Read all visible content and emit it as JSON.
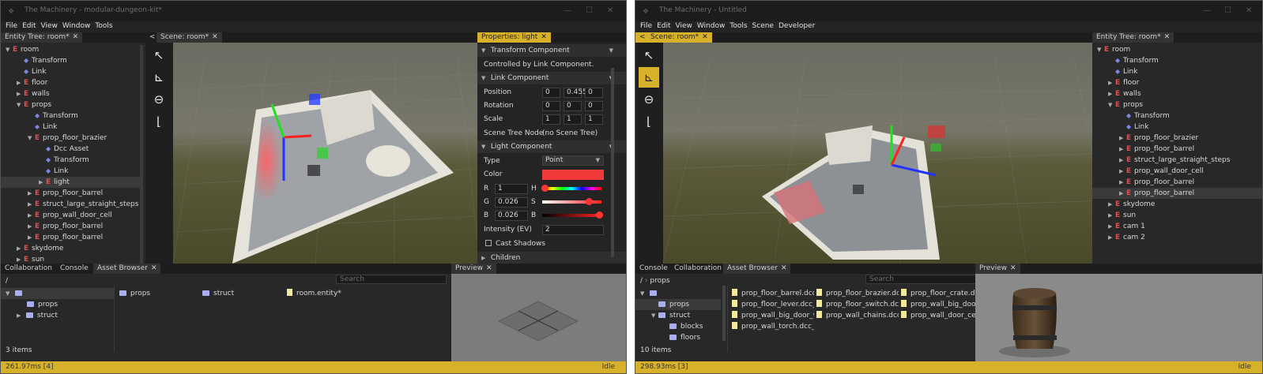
{
  "left": {
    "title": "The Machinery - modular-dungeon-kit*",
    "menu": [
      "File",
      "Edit",
      "View",
      "Window",
      "Tools"
    ],
    "tabs": {
      "entity_tree": "Entity Tree: room*",
      "scene_back": "<",
      "scene": "Scene: room*",
      "properties": "Properties: light",
      "collaboration": "Collaboration",
      "console": "Console",
      "asset_browser": "Asset Browser",
      "preview": "Preview"
    },
    "tree": [
      {
        "label": "room",
        "kind": "entity",
        "depth": 0,
        "arrow": "▼"
      },
      {
        "label": "Transform",
        "kind": "component",
        "depth": 1,
        "arrow": ""
      },
      {
        "label": "Link",
        "kind": "component",
        "depth": 1,
        "arrow": ""
      },
      {
        "label": "floor",
        "kind": "entity",
        "depth": 1,
        "arrow": "▶"
      },
      {
        "label": "walls",
        "kind": "entity",
        "depth": 1,
        "arrow": "▶"
      },
      {
        "label": "props",
        "kind": "entity",
        "depth": 1,
        "arrow": "▼"
      },
      {
        "label": "Transform",
        "kind": "component",
        "depth": 2,
        "arrow": ""
      },
      {
        "label": "Link",
        "kind": "component",
        "depth": 2,
        "arrow": ""
      },
      {
        "label": "prop_floor_brazier",
        "kind": "entity",
        "depth": 2,
        "arrow": "▼"
      },
      {
        "label": "Dcc Asset",
        "kind": "component",
        "depth": 3,
        "arrow": ""
      },
      {
        "label": "Transform",
        "kind": "component",
        "depth": 3,
        "arrow": ""
      },
      {
        "label": "Link",
        "kind": "component",
        "depth": 3,
        "arrow": ""
      },
      {
        "label": "light",
        "kind": "entity",
        "depth": 3,
        "arrow": "▶",
        "selected": true
      },
      {
        "label": "prop_floor_barrel",
        "kind": "entity",
        "depth": 2,
        "arrow": "▶"
      },
      {
        "label": "struct_large_straight_steps",
        "kind": "entity",
        "depth": 2,
        "arrow": "▶"
      },
      {
        "label": "prop_wall_door_cell",
        "kind": "entity",
        "depth": 2,
        "arrow": "▶"
      },
      {
        "label": "prop_floor_barrel",
        "kind": "entity",
        "depth": 2,
        "arrow": "▶"
      },
      {
        "label": "prop_floor_barrel",
        "kind": "entity",
        "depth": 2,
        "arrow": "▶"
      },
      {
        "label": "skydome",
        "kind": "entity",
        "depth": 1,
        "arrow": "▶"
      },
      {
        "label": "sun",
        "kind": "entity",
        "depth": 1,
        "arrow": "▶"
      }
    ],
    "properties": {
      "transform_header": "Transform Component",
      "controlled_note": "Controlled by Link Component.",
      "link_header": "Link Component",
      "position_label": "Position",
      "position": [
        "0",
        "0.455",
        "0"
      ],
      "rotation_label": "Rotation",
      "rotation": [
        "0",
        "0",
        "0"
      ],
      "scale_label": "Scale",
      "scale": [
        "1",
        "1",
        "1"
      ],
      "scene_tree_label": "Scene Tree Node",
      "scene_tree_value": "(no Scene Tree)",
      "light_header": "Light Component",
      "type_label": "Type",
      "type_value": "Point",
      "color_label": "Color",
      "color_hex": "#f23a3a",
      "r_label": "R",
      "r_value": "1",
      "h_label": "H",
      "g_label": "G",
      "g_value": "0.026",
      "s_label": "S",
      "b_label": "B",
      "b_value": "0.026",
      "b2_label": "B",
      "intensity_label": "Intensity (EV)",
      "intensity_value": "2",
      "cast_shadows": "Cast Shadows",
      "children_header": "Children"
    },
    "asset_browser": {
      "path": "/",
      "search_placeholder": "Search",
      "folders": [
        "props",
        "struct"
      ],
      "items": [
        "props",
        "struct",
        "room.entity*"
      ],
      "count": "3 items"
    },
    "status": {
      "left": "261.97ms [4]",
      "right": "Idle"
    }
  },
  "right": {
    "title": "The Machinery - Untitled",
    "menu": [
      "File",
      "Edit",
      "View",
      "Window",
      "Tools",
      "Scene",
      "Developer"
    ],
    "tabs": {
      "scene_back": "<",
      "scene": "Scene: room*",
      "entity_tree": "Entity Tree: room*",
      "console": "Console",
      "collaboration": "Collaboration",
      "asset_browser": "Asset Browser",
      "preview": "Preview"
    },
    "tree": [
      {
        "label": "room",
        "kind": "entity",
        "depth": 0,
        "arrow": "▼"
      },
      {
        "label": "Transform",
        "kind": "component",
        "depth": 1,
        "arrow": ""
      },
      {
        "label": "Link",
        "kind": "component",
        "depth": 1,
        "arrow": ""
      },
      {
        "label": "floor",
        "kind": "entity",
        "depth": 1,
        "arrow": "▶"
      },
      {
        "label": "walls",
        "kind": "entity",
        "depth": 1,
        "arrow": "▶"
      },
      {
        "label": "props",
        "kind": "entity",
        "depth": 1,
        "arrow": "▼"
      },
      {
        "label": "Transform",
        "kind": "component",
        "depth": 2,
        "arrow": ""
      },
      {
        "label": "Link",
        "kind": "component",
        "depth": 2,
        "arrow": ""
      },
      {
        "label": "prop_floor_brazier",
        "kind": "entity",
        "depth": 2,
        "arrow": "▶"
      },
      {
        "label": "prop_floor_barrel",
        "kind": "entity",
        "depth": 2,
        "arrow": "▶"
      },
      {
        "label": "struct_large_straight_steps",
        "kind": "entity",
        "depth": 2,
        "arrow": "▶"
      },
      {
        "label": "prop_wall_door_cell",
        "kind": "entity",
        "depth": 2,
        "arrow": "▶"
      },
      {
        "label": "prop_floor_barrel",
        "kind": "entity",
        "depth": 2,
        "arrow": "▶"
      },
      {
        "label": "prop_floor_barrel",
        "kind": "entity",
        "depth": 2,
        "arrow": "▶",
        "selected": true
      },
      {
        "label": "skydome",
        "kind": "entity",
        "depth": 1,
        "arrow": "▶"
      },
      {
        "label": "sun",
        "kind": "entity",
        "depth": 1,
        "arrow": "▶"
      },
      {
        "label": "cam 1",
        "kind": "entity",
        "depth": 1,
        "arrow": "▶"
      },
      {
        "label": "cam 2",
        "kind": "entity",
        "depth": 1,
        "arrow": "▶"
      }
    ],
    "asset_browser": {
      "path_root": "/",
      "path_current": "props",
      "search_placeholder": "Search",
      "folders": [
        {
          "label": "props",
          "depth": 1,
          "arrow": "",
          "selected": true
        },
        {
          "label": "struct",
          "depth": 1,
          "arrow": "▼"
        },
        {
          "label": "blocks",
          "depth": 2,
          "arrow": ""
        },
        {
          "label": "floors",
          "depth": 2,
          "arrow": ""
        }
      ],
      "files": [
        "prop_floor_barrel.dcc_as",
        "prop_floor_brazier.dcc_",
        "prop_floor_crate.dcc_as",
        "prop_floor_lever.dcc_as",
        "prop_floor_switch.dcc_a",
        "prop_wall_big_door_iro",
        "prop_wall_big_door_wo",
        "prop_wall_chains.dcc_a",
        "prop_wall_door_cell.dcc",
        "prop_wall_torch.dcc_ass"
      ],
      "count": "10 items"
    },
    "status": {
      "left": "298.93ms [3]",
      "right": "Idle"
    }
  }
}
